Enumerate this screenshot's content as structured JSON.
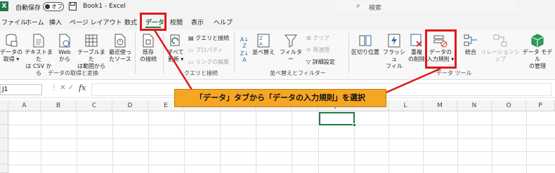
{
  "titlebar": {
    "logo": "X",
    "autosave_label": "自動保存",
    "toggle_label": "オフ",
    "title": "Book1 - Excel",
    "search_placeholder": "検索"
  },
  "menu": {
    "tabs": [
      "ファイル",
      "ホーム",
      "挿入",
      "ページ レイアウト",
      "数式",
      "データ",
      "校閲",
      "表示",
      "ヘルプ"
    ],
    "active_tab": "データ"
  },
  "ribbon": {
    "get_data": {
      "buttons": [
        {
          "label1": "データの",
          "label2": "取得 ▾"
        },
        {
          "label1": "テキストまた",
          "label2": "は CSV から"
        },
        {
          "label1": "Web",
          "label2": "から"
        },
        {
          "label1": "テーブルまた",
          "label2": "は範囲から"
        },
        {
          "label1": "最近使っ",
          "label2": "たソース"
        },
        {
          "label1": "既存",
          "label2": "の接続"
        }
      ],
      "group_label": "データの取得と変換"
    },
    "queries": {
      "refresh": {
        "label1": "すべて",
        "label2": "更新 ▾"
      },
      "small": [
        "クエリと接続",
        "プロパティ",
        "リンクの編集"
      ],
      "group_label": "クエリと接続"
    },
    "sort_filter": {
      "sort": "並べ替え",
      "filter": "フィルター",
      "small": [
        "クリア",
        "再適用",
        "詳細設定"
      ],
      "group_label": "並べ替えとフィルター"
    },
    "data_tools": {
      "buttons": [
        {
          "label1": "区切り位置",
          "label2": ""
        },
        {
          "label1": "フラッシュ",
          "label2": "フィル"
        },
        {
          "label1": "重複",
          "label2": "の削除"
        },
        {
          "label1": "データの",
          "label2": "入力規則 ▾"
        },
        {
          "label1": "統合",
          "label2": ""
        },
        {
          "label1": "リレーションシップ",
          "label2": ""
        },
        {
          "label1": "データ モデル",
          "label2": "の管理"
        }
      ],
      "group_label": "データ ツール"
    }
  },
  "formula_bar": {
    "name_box": "J1",
    "cancel": "✕",
    "enter": "✓",
    "fx": "fx"
  },
  "sheet": {
    "columns": [
      "A",
      "B",
      "C",
      "D",
      "E",
      "F",
      "G",
      "H",
      "I",
      "J",
      "K",
      "L",
      "M",
      "N",
      "O",
      "P"
    ]
  },
  "annotation": {
    "callout": "「データ」タブから「データの入力規則」を選択",
    "highlight_color": "#e01919",
    "callout_color": "#f5a623"
  }
}
